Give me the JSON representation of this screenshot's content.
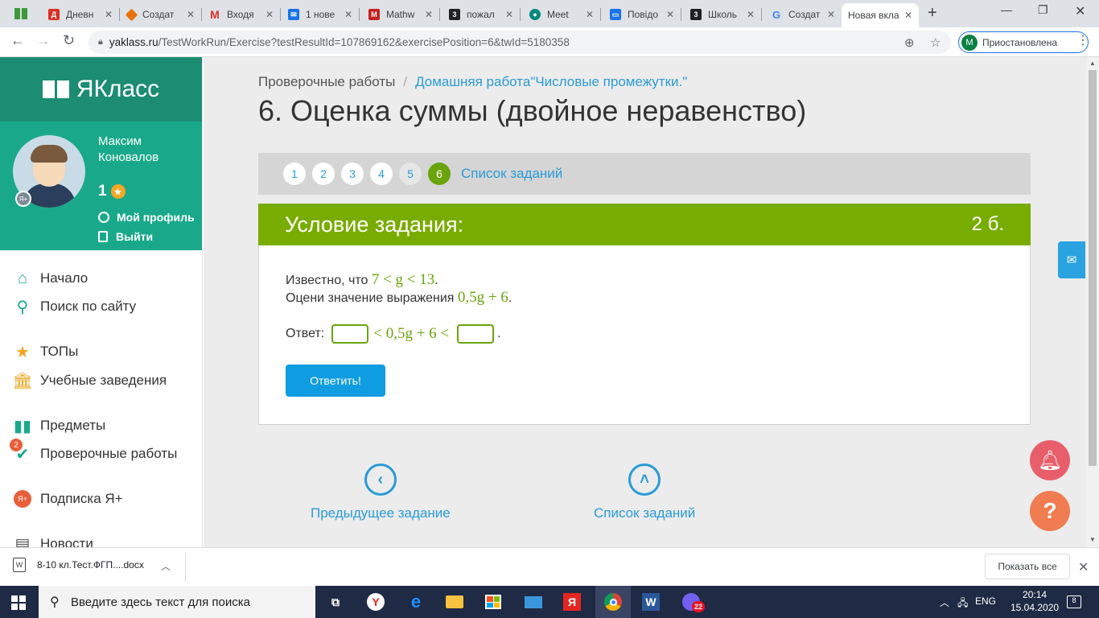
{
  "browser": {
    "tabs": [
      {
        "title": "Дневн",
        "icon": "diary-icon",
        "color": "#d93025"
      },
      {
        "title": "Создат",
        "icon": "forms-icon",
        "color": "#e8710a"
      },
      {
        "title": "Входя",
        "icon": "gmail-icon",
        "color": "#d93025"
      },
      {
        "title": "1 нове",
        "icon": "mail-icon",
        "color": "#1a73e8"
      },
      {
        "title": "Mathw",
        "icon": "mathway-icon",
        "color": "#c5221f"
      },
      {
        "title": "пожал",
        "icon": "znanija-icon",
        "color": "#202124"
      },
      {
        "title": "Meet",
        "icon": "meet-icon",
        "color": "#00897b"
      },
      {
        "title": "Повідо",
        "icon": "chat-icon",
        "color": "#1a73e8"
      },
      {
        "title": "Школь",
        "icon": "znanija-icon",
        "color": "#202124"
      },
      {
        "title": "Создат",
        "icon": "google-icon",
        "color": "#4285f4"
      },
      {
        "title": "Новая вкла",
        "icon": "",
        "color": ""
      }
    ],
    "url_host": "yaklass.ru",
    "url_path": "/TestWorkRun/Exercise?testResultId=107869162&exercisePosition=6&twId=5180358",
    "profile_initial": "M",
    "profile_label": "Приостановлена"
  },
  "sidebar": {
    "logo": "ЯКласс",
    "user_name": "Максим Коновалов",
    "points": "1",
    "profile_link": "Мой профиль",
    "logout_link": "Выйти",
    "items": [
      {
        "label": "Начало"
      },
      {
        "label": "Поиск по сайту"
      },
      {
        "label": "ТОПы"
      },
      {
        "label": "Учебные заведения"
      },
      {
        "label": "Предметы"
      },
      {
        "label": "Проверочные работы",
        "badge": "2"
      },
      {
        "label": "Подписка Я+"
      },
      {
        "label": "Новости"
      }
    ]
  },
  "main": {
    "breadcrumb_root": "Проверочные работы",
    "breadcrumb_sep": "/",
    "breadcrumb_current": "Домашняя работа\"Числовые промежутки.\"",
    "title": "6. Оценка суммы (двойное неравенство)",
    "numbers": [
      "1",
      "2",
      "3",
      "4",
      "5",
      "6"
    ],
    "active_number": "6",
    "task_list_link": "Список заданий",
    "task_header": "Условие задания:",
    "task_points": "2 б.",
    "line1_prefix": "Известно, что",
    "line1_math": "7 < g < 13",
    "line2_prefix": "Оцени значение выражения",
    "line2_math": "0,5g + 6",
    "answer_label": "Ответ:",
    "answer_math": "< 0,5g + 6 <",
    "submit": "Ответить!",
    "prev_link": "Предыдущее задание",
    "list_link": "Список заданий"
  },
  "downloads": {
    "file": "8-10 кл.Тест.ФГП....docx",
    "show_all": "Показать все"
  },
  "taskbar": {
    "search_placeholder": "Введите здесь текст для поиска",
    "lang": "ENG",
    "time": "20:14",
    "date": "15.04.2020",
    "viber_badge": "22",
    "notif_count": "8"
  }
}
